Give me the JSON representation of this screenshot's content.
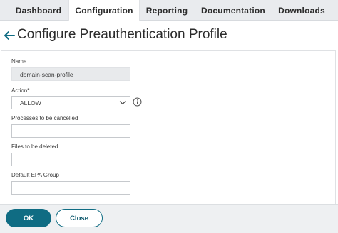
{
  "tabs": [
    {
      "label": "Dashboard",
      "active": false
    },
    {
      "label": "Configuration",
      "active": true
    },
    {
      "label": "Reporting",
      "active": false
    },
    {
      "label": "Documentation",
      "active": false
    },
    {
      "label": "Downloads",
      "active": false
    }
  ],
  "header": {
    "back_icon": "back-arrow-icon",
    "title": "Configure Preauthentication Profile"
  },
  "form": {
    "name": {
      "label": "Name",
      "value": "domain-scan-profile",
      "disabled": true
    },
    "action": {
      "label": "Action*",
      "value": "ALLOW",
      "icon": "chevron-down-icon",
      "info_icon": "info-icon"
    },
    "processes": {
      "label": "Processes to be cancelled",
      "value": ""
    },
    "files": {
      "label": "Files to be deleted",
      "value": ""
    },
    "epa_group": {
      "label": "Default EPA Group",
      "value": ""
    }
  },
  "footer": {
    "ok_label": "OK",
    "close_label": "Close"
  },
  "colors": {
    "accent": "#0f6c83",
    "tabbar_bg": "#e9ebee",
    "footer_bg": "#eef0f2"
  }
}
